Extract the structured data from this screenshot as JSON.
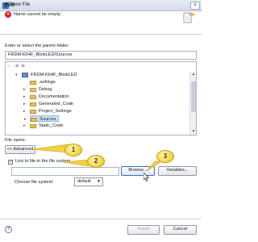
{
  "window": {
    "title": "New File",
    "close_glyph": "×"
  },
  "header": {
    "title": "File",
    "error_message": "Name cannot be empty.",
    "error_icon": "error-icon",
    "error_color": "#d42020"
  },
  "parent_folder": {
    "label": "Enter or select the parent folder:",
    "value": "FRDM-K64F_BlinkLED/Sources"
  },
  "tree": {
    "toolbar_icons": [
      "home-icon",
      "back-icon",
      "forward-icon"
    ],
    "items": [
      {
        "label": "FRDM-K64F_BlinkLED",
        "type": "project",
        "expanded": true,
        "selected": false
      },
      {
        "label": ".settings",
        "type": "folder",
        "expanded": false,
        "selected": false
      },
      {
        "label": "Debug",
        "type": "folder",
        "expanded": false,
        "selected": false
      },
      {
        "label": "Documentation",
        "type": "folder",
        "expanded": false,
        "selected": false
      },
      {
        "label": "Generated_Code",
        "type": "folder",
        "expanded": false,
        "selected": false
      },
      {
        "label": "Project_Settings",
        "type": "folder",
        "expanded": false,
        "selected": false
      },
      {
        "label": "Sources",
        "type": "folder",
        "expanded": false,
        "selected": true
      },
      {
        "label": "Static_Code",
        "type": "folder",
        "expanded": false,
        "selected": false
      }
    ]
  },
  "file_name": {
    "label": "File name:",
    "value": ""
  },
  "advanced": {
    "button_label": "<< Advanced",
    "link_checkbox_label": "Link to file in the file system",
    "link_checked": true,
    "link_value": "",
    "browse_label": "Browse...",
    "variables_label": "Variables...",
    "filesystem_label": "Choose file system:",
    "filesystem_value": "default"
  },
  "callouts": [
    "1",
    "2",
    "3"
  ],
  "footer": {
    "help_glyph": "?",
    "finish_label": "Finish",
    "cancel_label": "Cancel"
  },
  "colors": {
    "callout_fill": "#f1d23f",
    "selection": "#cfe3f7",
    "accent": "#2e6fd0"
  }
}
